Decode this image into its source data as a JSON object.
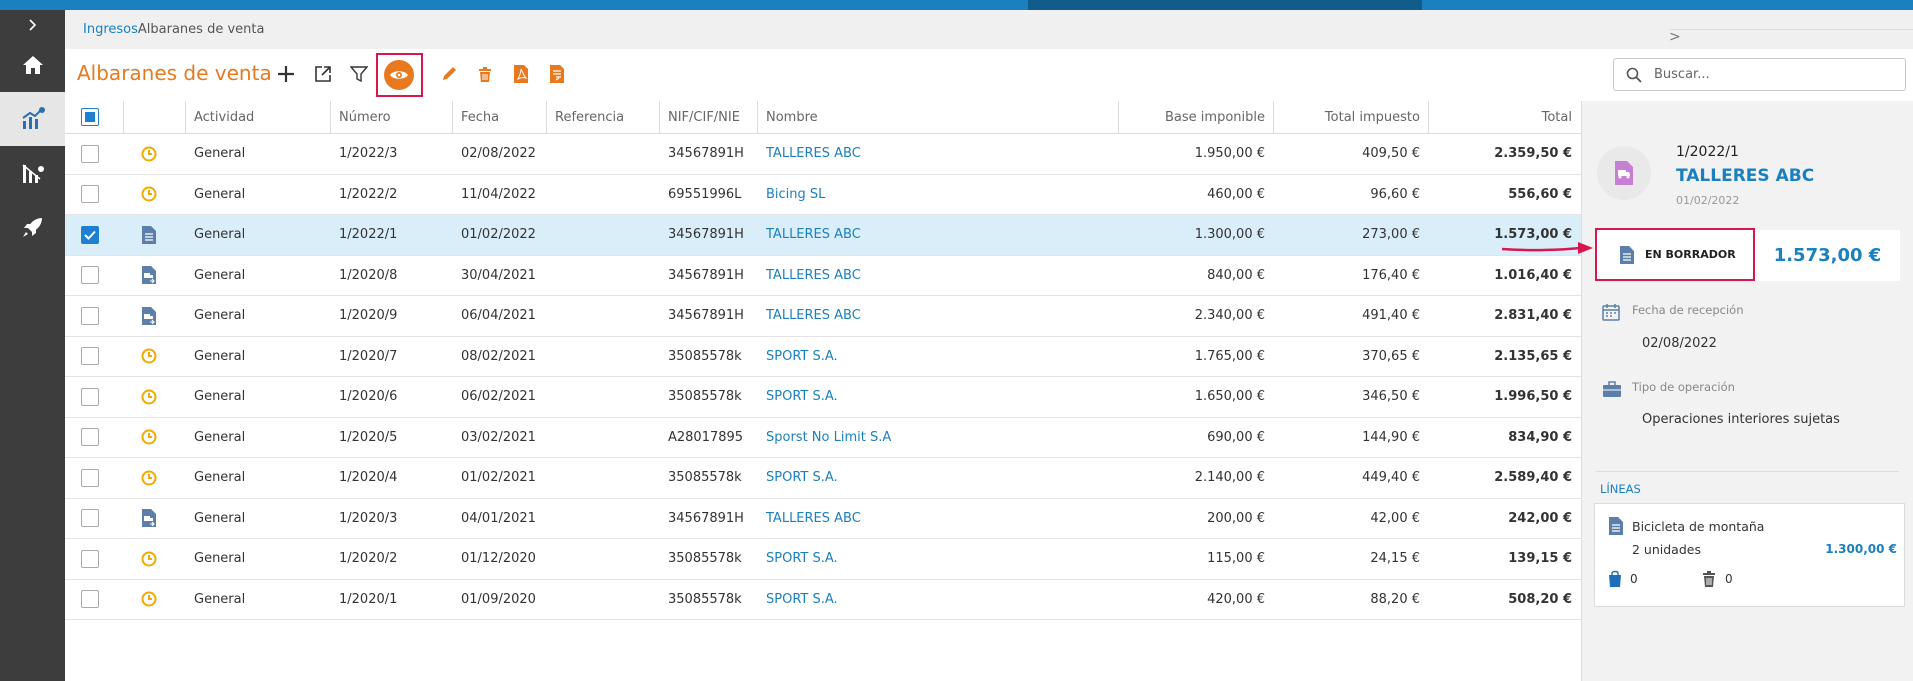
{
  "breadcrumb": {
    "parent": "Ingresos",
    "separator": ">",
    "current": "Albaranes de venta"
  },
  "page_title": "Albaranes de venta",
  "search": {
    "placeholder": "Buscar..."
  },
  "table": {
    "columns": [
      "Actividad",
      "Número",
      "Fecha",
      "Referencia",
      "NIF/CIF/NIE",
      "Nombre",
      "Base imponible",
      "Total impuesto",
      "Total"
    ],
    "rows": [
      {
        "icon": "clock-icon",
        "checked": false,
        "selected": false,
        "actividad": "General",
        "numero": "1/2022/3",
        "fecha": "02/08/2022",
        "referencia": "",
        "nif": "34567891H",
        "nombre": "TALLERES ABC",
        "base": "1.950,00 €",
        "impuesto": "409,50 €",
        "total": "2.359,50 €"
      },
      {
        "icon": "clock-icon",
        "checked": false,
        "selected": false,
        "actividad": "General",
        "numero": "1/2022/2",
        "fecha": "11/04/2022",
        "referencia": "",
        "nif": "69551996L",
        "nombre": "Bicing SL",
        "base": "460,00 €",
        "impuesto": "96,60 €",
        "total": "556,60 €"
      },
      {
        "icon": "document-icon",
        "checked": true,
        "selected": true,
        "actividad": "General",
        "numero": "1/2022/1",
        "fecha": "01/02/2022",
        "referencia": "",
        "nif": "34567891H",
        "nombre": "TALLERES ABC",
        "base": "1.300,00 €",
        "impuesto": "273,00 €",
        "total": "1.573,00 €"
      },
      {
        "icon": "delivery-note-icon",
        "checked": false,
        "selected": false,
        "actividad": "General",
        "numero": "1/2020/8",
        "fecha": "30/04/2021",
        "referencia": "",
        "nif": "34567891H",
        "nombre": "TALLERES ABC",
        "base": "840,00 €",
        "impuesto": "176,40 €",
        "total": "1.016,40 €"
      },
      {
        "icon": "delivery-note-icon",
        "checked": false,
        "selected": false,
        "actividad": "General",
        "numero": "1/2020/9",
        "fecha": "06/04/2021",
        "referencia": "",
        "nif": "34567891H",
        "nombre": "TALLERES ABC",
        "base": "2.340,00 €",
        "impuesto": "491,40 €",
        "total": "2.831,40 €"
      },
      {
        "icon": "clock-icon",
        "checked": false,
        "selected": false,
        "actividad": "General",
        "numero": "1/2020/7",
        "fecha": "08/02/2021",
        "referencia": "",
        "nif": "35085578k",
        "nombre": "SPORT S.A.",
        "base": "1.765,00 €",
        "impuesto": "370,65 €",
        "total": "2.135,65 €"
      },
      {
        "icon": "clock-icon",
        "checked": false,
        "selected": false,
        "actividad": "General",
        "numero": "1/2020/6",
        "fecha": "06/02/2021",
        "referencia": "",
        "nif": "35085578k",
        "nombre": "SPORT S.A.",
        "base": "1.650,00 €",
        "impuesto": "346,50 €",
        "total": "1.996,50 €"
      },
      {
        "icon": "clock-icon",
        "checked": false,
        "selected": false,
        "actividad": "General",
        "numero": "1/2020/5",
        "fecha": "03/02/2021",
        "referencia": "",
        "nif": "A28017895",
        "nombre": "Sporst No Limit S.A",
        "base": "690,00 €",
        "impuesto": "144,90 €",
        "total": "834,90 €"
      },
      {
        "icon": "clock-icon",
        "checked": false,
        "selected": false,
        "actividad": "General",
        "numero": "1/2020/4",
        "fecha": "01/02/2021",
        "referencia": "",
        "nif": "35085578k",
        "nombre": "SPORT S.A.",
        "base": "2.140,00 €",
        "impuesto": "449,40 €",
        "total": "2.589,40 €"
      },
      {
        "icon": "delivery-note-icon",
        "checked": false,
        "selected": false,
        "actividad": "General",
        "numero": "1/2020/3",
        "fecha": "04/01/2021",
        "referencia": "",
        "nif": "34567891H",
        "nombre": "TALLERES ABC",
        "base": "200,00 €",
        "impuesto": "42,00 €",
        "total": "242,00 €"
      },
      {
        "icon": "clock-icon",
        "checked": false,
        "selected": false,
        "actividad": "General",
        "numero": "1/2020/2",
        "fecha": "01/12/2020",
        "referencia": "",
        "nif": "35085578k",
        "nombre": "SPORT S.A.",
        "base": "115,00 €",
        "impuesto": "24,15 €",
        "total": "139,15 €"
      },
      {
        "icon": "clock-icon",
        "checked": false,
        "selected": false,
        "actividad": "General",
        "numero": "1/2020/1",
        "fecha": "01/09/2020",
        "referencia": "",
        "nif": "35085578k",
        "nombre": "SPORT S.A.",
        "base": "420,00 €",
        "impuesto": "88,20 €",
        "total": "508,20 €"
      }
    ]
  },
  "detail": {
    "number": "1/2022/1",
    "client": "TALLERES ABC",
    "date": "01/02/2022",
    "status": "EN BORRADOR",
    "amount": "1.573,00 €",
    "reception_label": "Fecha de recepción",
    "reception_value": "02/08/2022",
    "operation_label": "Tipo de operación",
    "operation_value": "Operaciones interiores sujetas",
    "lines_title": "LÍNEAS",
    "line": {
      "description": "Bicicleta de montaña",
      "quantity": "2 unidades",
      "amount": "1.300,00 €",
      "bag_count": "0",
      "trash_count": "0"
    }
  },
  "colors": {
    "accent": "#e8791e",
    "link": "#1a80c0",
    "highlight": "#d8174f",
    "selected_row": "#d9eef9",
    "sidebar": "#3d3d3d"
  }
}
